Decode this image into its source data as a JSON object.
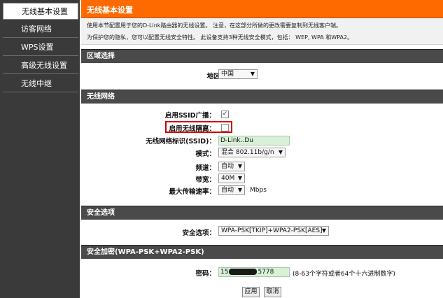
{
  "sidebar": {
    "items": [
      {
        "label": "无线基本设置",
        "active": true
      },
      {
        "label": "访客网络",
        "active": false
      },
      {
        "label": "WPS设置",
        "active": false
      },
      {
        "label": "高级无线设置",
        "active": false
      },
      {
        "label": "无线中继",
        "active": false
      }
    ]
  },
  "header": {
    "title": "无线基本设置",
    "intro_line1": "使用本节配置用于您的D-Link路由器的无线设置。 注意，在这部分所做的更改需要复制到无线客户端。",
    "intro_line2": "为保护您的隐私，您可以配置无线安全特性。 此设备支持3种无线安全模式，包括： WEP, WPA 和WPA2。"
  },
  "region_section": {
    "title": "区域选择",
    "region_label": "地区：",
    "region_value": "中国"
  },
  "wireless_section": {
    "title": "无线网络",
    "ssid_broadcast_label": "启用SSID广播：",
    "ssid_broadcast_checked": true,
    "isolation_label": "启用无线隔离：",
    "isolation_checked": false,
    "ssid_label": "无线网络标识(SSID)：",
    "ssid_value": "D-Link..Du",
    "mode_label": "模式：",
    "mode_value": "混合 802.11b/g/n",
    "channel_label": "频道：",
    "channel_value": "自动",
    "bandwidth_label": "带宽：",
    "bandwidth_value": "40M",
    "max_rate_label": "最大传输速率：",
    "max_rate_value": "自动",
    "max_rate_unit": "Mbps"
  },
  "security_section": {
    "title": "安全选项",
    "security_label": "安全选项：",
    "security_value": "WPA-PSK[TKIP]+WPA2-PSK[AES]"
  },
  "encryption_section": {
    "title": "安全加密(WPA-PSK+WPA2-PSK)",
    "password_label": "密码：",
    "password_prefix": "15",
    "password_suffix": "5778",
    "password_hint": "(8-63个字符或者64个十六进制数字)"
  },
  "buttons": {
    "apply": "应用",
    "cancel": "取消"
  }
}
